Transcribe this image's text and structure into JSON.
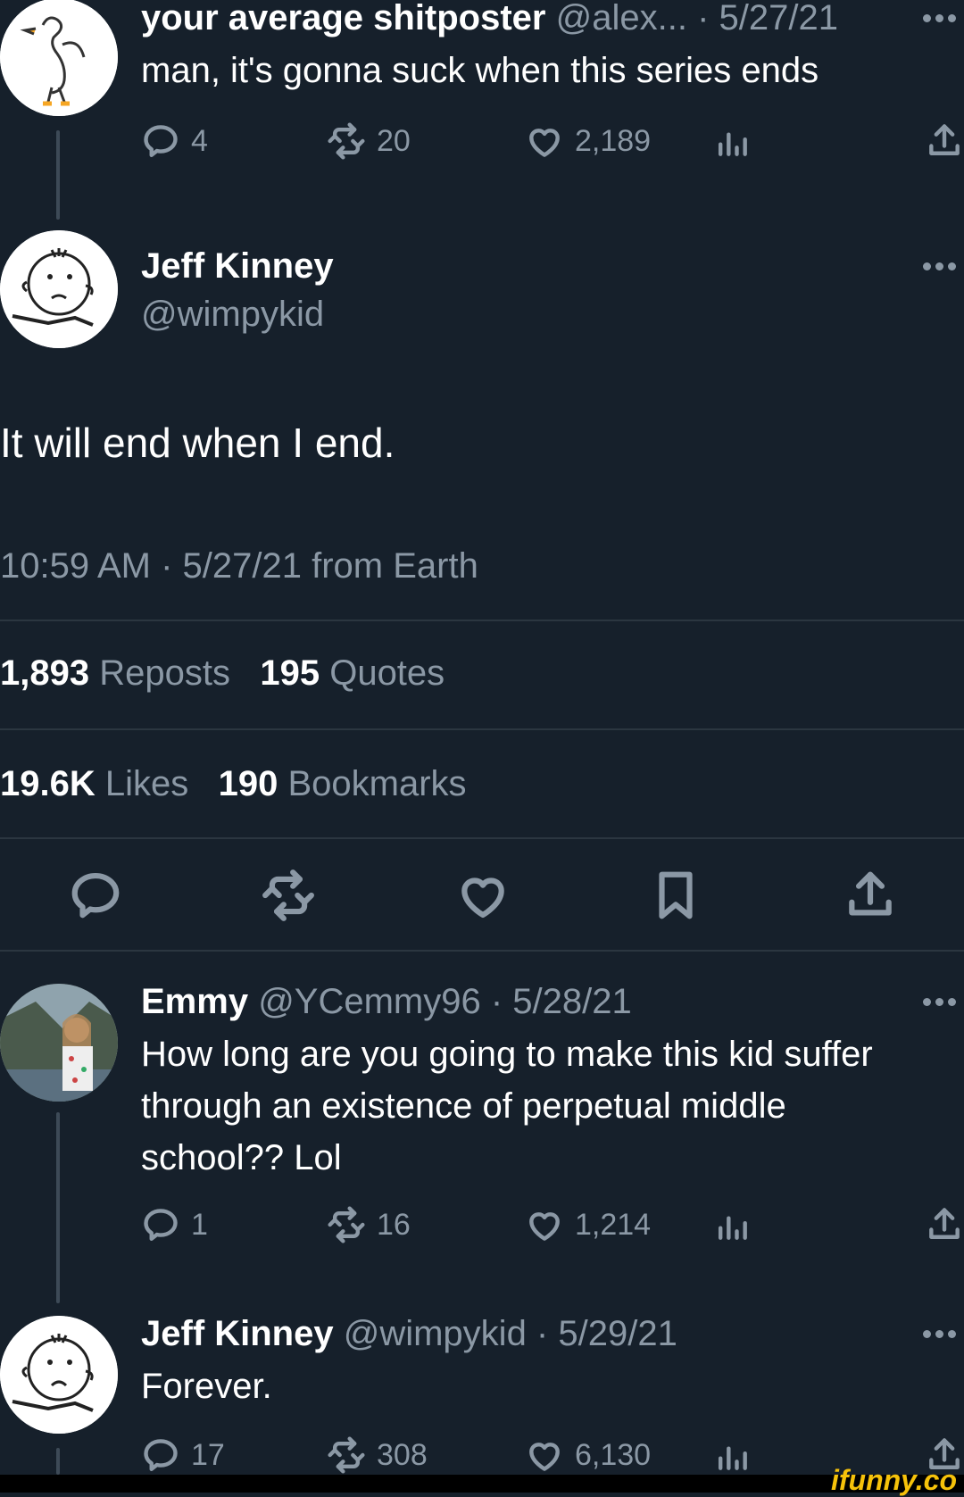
{
  "tweet1": {
    "name": "your average shitposter",
    "meta": "@alex... · 5/27/21",
    "text": "man, it's gonna suck when this series ends",
    "replies": "4",
    "reposts": "20",
    "likes": "2,189"
  },
  "main": {
    "name": "Jeff Kinney",
    "handle": "@wimpykid",
    "text": "It will end when I end.",
    "timestamp": "10:59 AM · 5/27/21 from Earth",
    "reposts_count": "1,893",
    "reposts_label": "Reposts",
    "quotes_count": "195",
    "quotes_label": "Quotes",
    "likes_count": "19.6K",
    "likes_label": "Likes",
    "bookmarks_count": "190",
    "bookmarks_label": "Bookmarks"
  },
  "reply1": {
    "name": "Emmy",
    "meta": "@YCemmy96 · 5/28/21",
    "text": "How long are you going to make this kid suffer through an existence of perpetual middle school?? Lol",
    "replies": "1",
    "reposts": "16",
    "likes": "1,214"
  },
  "reply2": {
    "name": "Jeff Kinney",
    "meta": "@wimpykid · 5/29/21",
    "text": "Forever.",
    "replies": "17",
    "reposts": "308",
    "likes": "6,130"
  },
  "watermark": "ifunny.co",
  "colors": {
    "background": "#16202b",
    "muted": "#8b98a5",
    "divider": "#2b3640"
  },
  "icons": [
    "reply-icon",
    "repost-icon",
    "like-icon",
    "views-icon",
    "share-icon",
    "bookmark-icon",
    "more-icon"
  ]
}
